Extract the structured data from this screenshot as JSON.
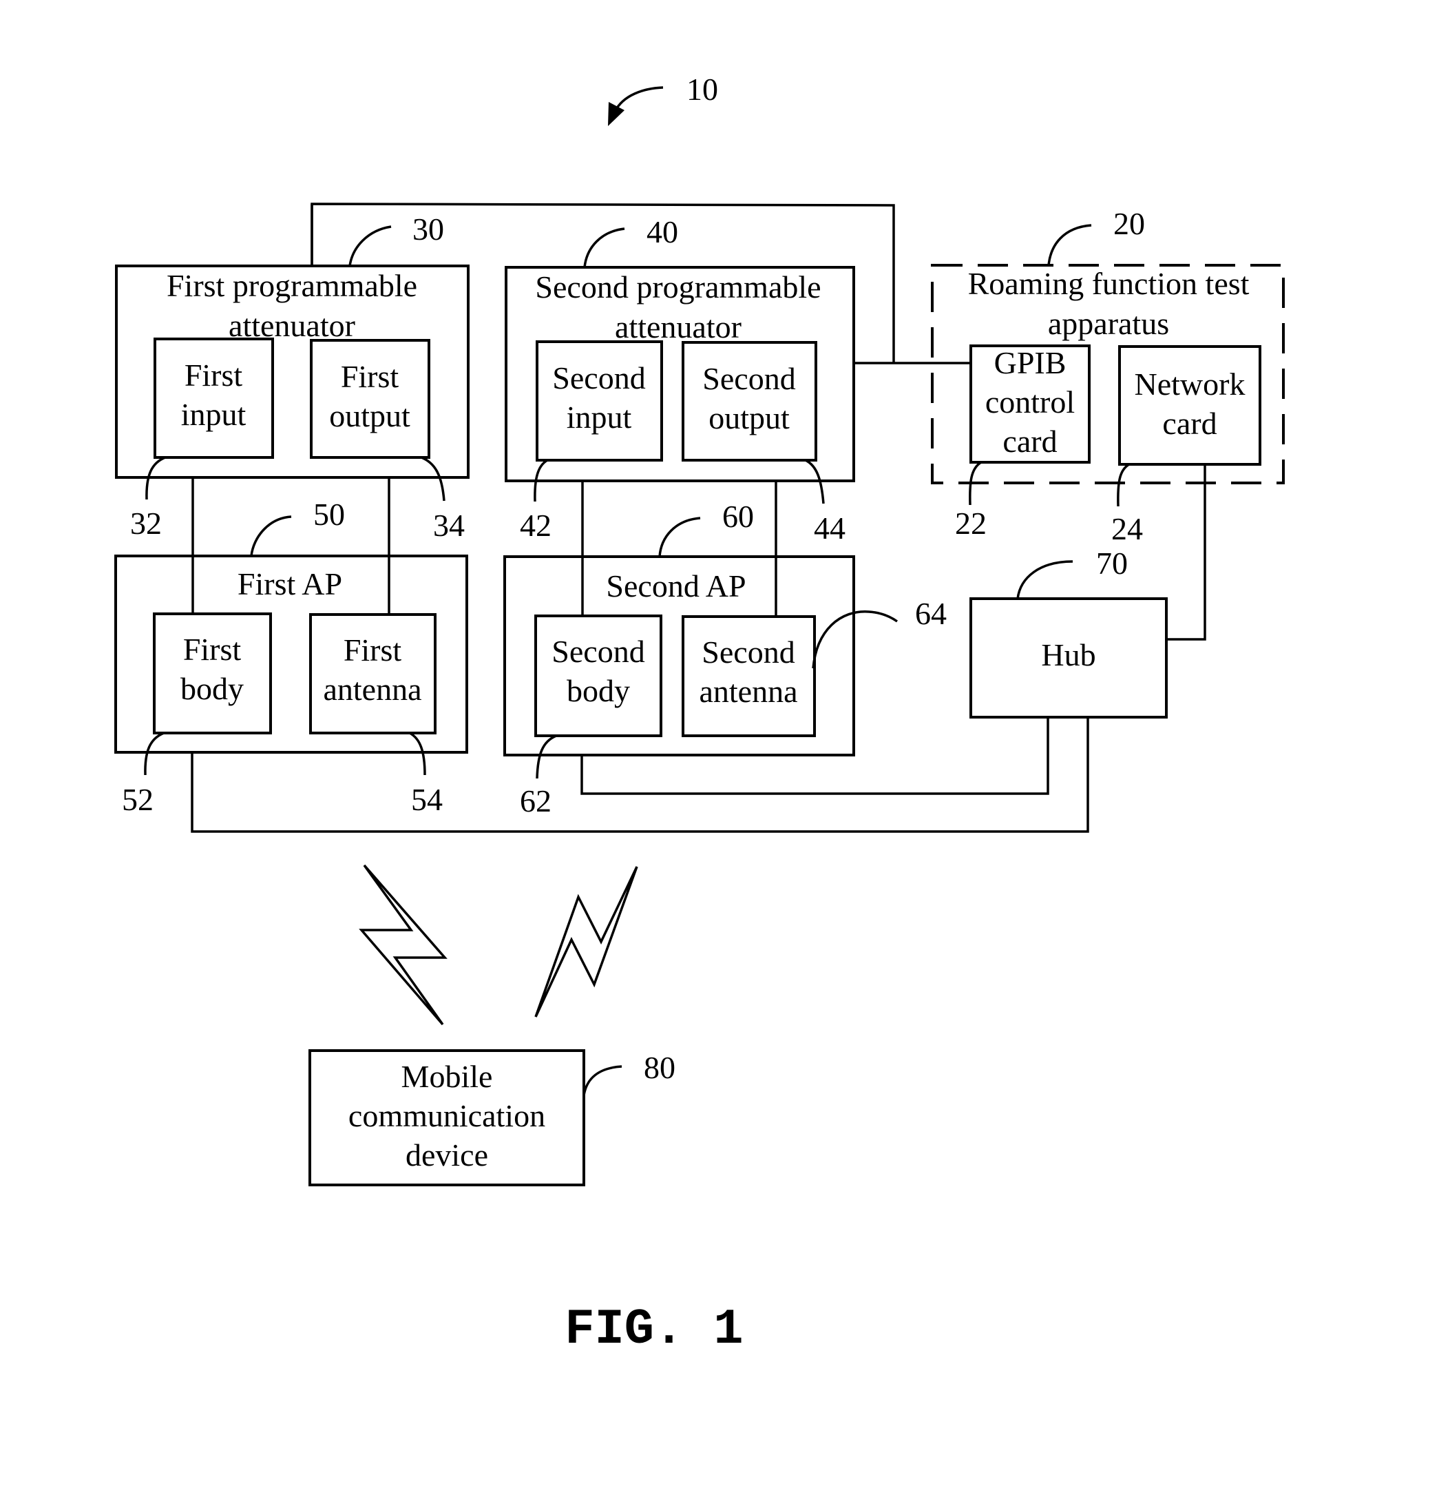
{
  "figure": {
    "caption": "FIG. 1",
    "system_ref": "10"
  },
  "blocks": {
    "roaming_apparatus": {
      "ref": "20",
      "label_line1": "Roaming function test",
      "label_line2": "apparatus"
    },
    "gpib_card": {
      "ref": "22",
      "label_line1": "GPIB",
      "label_line2": "control",
      "label_line3": "card"
    },
    "network_card": {
      "ref": "24",
      "label_line1": "Network",
      "label_line2": "card"
    },
    "first_attenuator": {
      "ref": "30",
      "label_line1": "First programmable",
      "label_line2": "attenuator"
    },
    "first_input": {
      "ref": "32",
      "label_line1": "First",
      "label_line2": "input"
    },
    "first_output": {
      "ref": "34",
      "label_line1": "First",
      "label_line2": "output"
    },
    "second_attenuator": {
      "ref": "40",
      "label_line1": "Second programmable",
      "label_line2": "attenuator"
    },
    "second_input": {
      "ref": "42",
      "label_line1": "Second",
      "label_line2": "input"
    },
    "second_output": {
      "ref": "44",
      "label_line1": "Second",
      "label_line2": "output"
    },
    "first_ap": {
      "ref": "50",
      "label": "First AP"
    },
    "first_body": {
      "ref": "52",
      "label_line1": "First",
      "label_line2": "body"
    },
    "first_antenna": {
      "ref": "54",
      "label_line1": "First",
      "label_line2": "antenna"
    },
    "second_ap": {
      "ref": "60",
      "label": "Second AP"
    },
    "second_body": {
      "ref": "62",
      "label_line1": "Second",
      "label_line2": "body"
    },
    "second_antenna": {
      "ref": "64",
      "label_line1": "Second",
      "label_line2": "antenna"
    },
    "hub": {
      "ref": "70",
      "label": "Hub"
    },
    "mobile_device": {
      "ref": "80",
      "label_line1": "Mobile",
      "label_line2": "communication",
      "label_line3": "device"
    }
  }
}
